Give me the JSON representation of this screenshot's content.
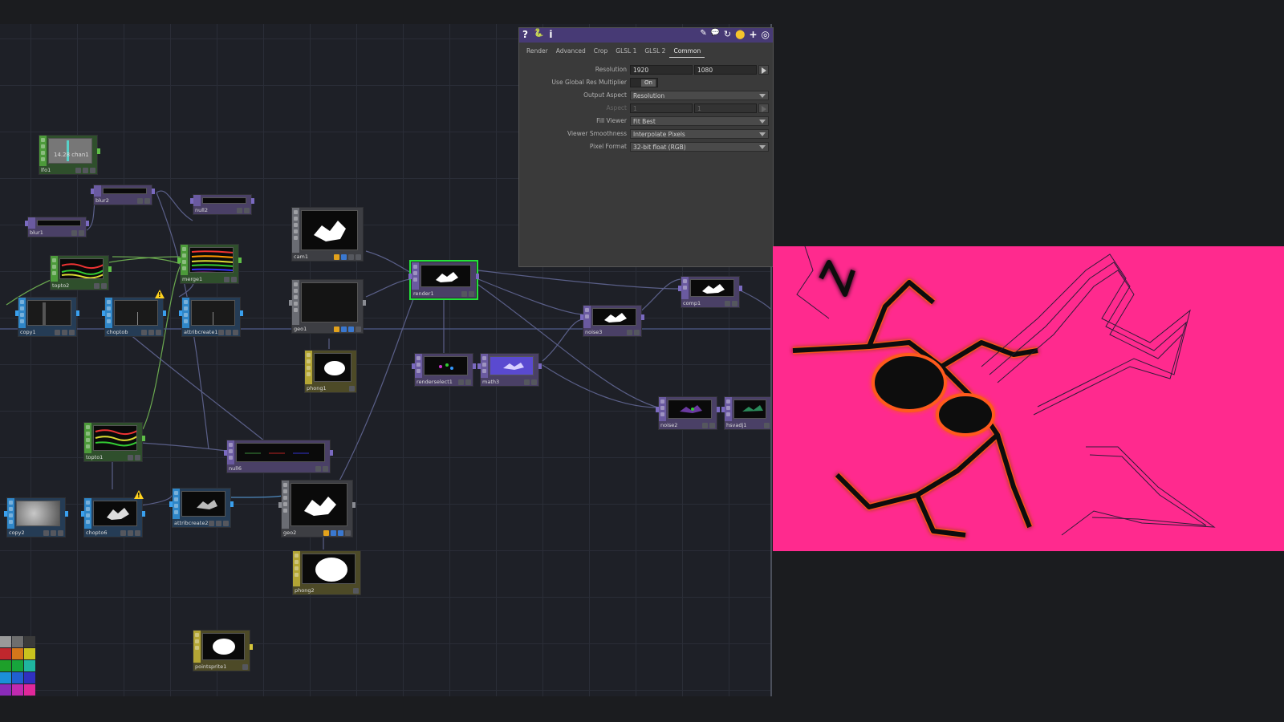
{
  "param_panel": {
    "toolbar_left": [
      "?",
      "🐍",
      "i"
    ],
    "toolbar_right": [
      "✎",
      "💬",
      "↻",
      "⬤",
      "+",
      "◎"
    ],
    "tabs": [
      "Render",
      "Advanced",
      "Crop",
      "GLSL 1",
      "GLSL 2",
      "Common"
    ],
    "active_tab": "Common",
    "params": {
      "resolution": {
        "label": "Resolution",
        "w": "1920",
        "h": "1080"
      },
      "global_res": {
        "label": "Use Global Res Multiplier",
        "value": "On"
      },
      "output_aspect": {
        "label": "Output Aspect",
        "value": "Resolution"
      },
      "aspect": {
        "label": "Aspect",
        "a": "1",
        "b": "1"
      },
      "fill_viewer": {
        "label": "Fill Viewer",
        "value": "Fit Best"
      },
      "viewer_smoothness": {
        "label": "Viewer Smoothness",
        "value": "Interpolate Pixels"
      },
      "pixel_format": {
        "label": "Pixel Format",
        "value": "32-bit float (RGB)"
      }
    }
  },
  "nodes": {
    "lfo1": "lfo1",
    "lfo1_text": "14.28 chan1",
    "blur2": "blur2",
    "null2": "null2",
    "blur1": "blur1",
    "topto2": "topto2",
    "merge1": "merge1",
    "cam1": "cam1",
    "copy1": "copy1",
    "choptob": "choptob",
    "attribcreate1": "attribcreate1",
    "geo1": "geo1",
    "render1": "render1",
    "comp1": "comp1",
    "noise3": "noise3",
    "phong1": "phong1",
    "renderselect1": "renderselect1",
    "math3": "math3",
    "noise2": "noise2",
    "hsvadj1": "hsvadj1",
    "topto1": "topto1",
    "null6": "null6",
    "copy2": "copy2",
    "chopto6": "chopto6",
    "attribcreate2": "attribcreate2",
    "geo2": "geo2",
    "phong2": "phong2",
    "pointsprite1": "pointsprite1"
  },
  "colors": {
    "viewer_bg": "#ff2a8e",
    "selection": "#23e23a",
    "warning": "#ffd21e",
    "palette": [
      "#9a9a9a",
      "#6e6e6e",
      "#3a3a3a",
      "#c0272d",
      "#d4761a",
      "#c9c21e",
      "#1ea02a",
      "#17a53c",
      "#1fb5a0",
      "#1c8fd8",
      "#2060d0",
      "#3030c0",
      "#8a2bb8",
      "#c02ab0",
      "#e0289a"
    ]
  },
  "icons": [
    "help-icon",
    "python-icon",
    "info-icon",
    "edit-icon",
    "comment-icon",
    "refresh-icon",
    "python-globe-icon",
    "add-icon",
    "target-icon",
    "warning-icon"
  ]
}
